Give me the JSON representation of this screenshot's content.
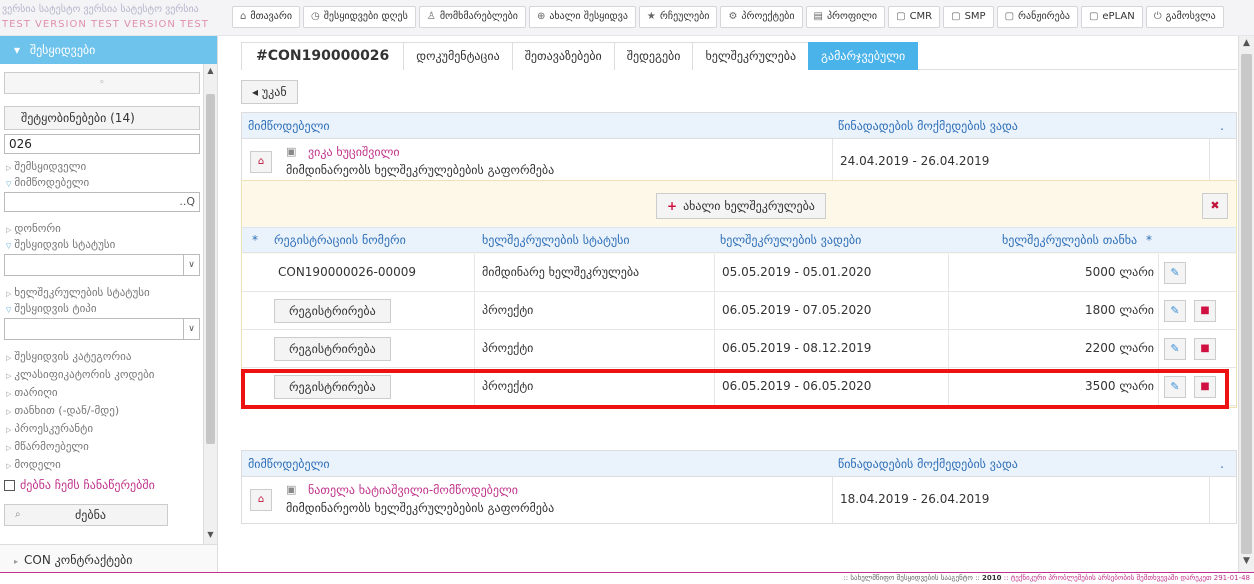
{
  "watermark": {
    "line1": "ვერსია  სატესტო ვერსია  სატესტო ვერსია",
    "line2": "TEST VERSION  TEST VERSION  TEST"
  },
  "topnav": [
    {
      "icon": "home-icon",
      "glyph": "⌂",
      "label": "მთავარი"
    },
    {
      "icon": "clock-icon",
      "glyph": "◷",
      "label": "შესყიდვები დღეს"
    },
    {
      "icon": "user-icon",
      "glyph": "♙",
      "label": "მომხმარებლები"
    },
    {
      "icon": "plus-circle-icon",
      "glyph": "⊕",
      "label": "ახალი შესყიდვა"
    },
    {
      "icon": "star-icon",
      "glyph": "★",
      "label": "რჩეულები"
    },
    {
      "icon": "gear-icon",
      "glyph": "⚙",
      "label": "პროექტები"
    },
    {
      "icon": "card-icon",
      "glyph": "▤",
      "label": "პროფილი"
    },
    {
      "icon": "doc-icon",
      "glyph": "▢",
      "label": "CMR"
    },
    {
      "icon": "doc-icon",
      "glyph": "▢",
      "label": "SMP"
    },
    {
      "icon": "doc-icon",
      "glyph": "▢",
      "label": "რანჟირება"
    },
    {
      "icon": "doc-icon",
      "glyph": "▢",
      "label": "ePLAN"
    },
    {
      "icon": "power-icon",
      "glyph": "⏻",
      "label": "გამოსვლა"
    }
  ],
  "sidebar": {
    "header": "შესყიდვები",
    "header_glyph": "▾",
    "small_btn_glyph": "◦",
    "notifications": "შეტყობინებები (14)",
    "code_value": "026",
    "labels": {
      "buyer": "შემსყიდველი",
      "supplier": "მიმწოდებელი",
      "date": "დონორი",
      "procurement_status": "შესყიდვის სტატუსი",
      "contract_status": "ხელშეკრულების სტატუსი",
      "procurement_type": "შესყიდვის ტიპი",
      "procurement_category": "შესყიდვის კატეგორია",
      "classifier_code": "კლასიფიკატორის კოდები",
      "date2": "თარიღი",
      "amount": "თანხით (-დან/-მდე)",
      "project_name": "პროესკურანტი",
      "producer": "მწარმოებელი",
      "model": "მოდელი"
    },
    "supplier_suffix": "..Q",
    "search_my_records": "ძებნა ჩემს ჩანაწერებში",
    "search_btn": "ძებნა",
    "search_glyph": "⌕",
    "footer": "CON კონტრაქტები",
    "footer_glyph": "▸"
  },
  "tabs": [
    {
      "label": "#CON190000026",
      "active": false
    },
    {
      "label": "დოკუმენტაცია",
      "active": false
    },
    {
      "label": "შეთავაზებები",
      "active": false
    },
    {
      "label": "შედეგები",
      "active": false
    },
    {
      "label": "ხელშეკრულება",
      "active": false
    },
    {
      "label": "გამარჯვებული",
      "active": true
    }
  ],
  "back_btn": "◂ უკან",
  "supplier_header": {
    "col1": "მიმწოდებელი",
    "col2": "წინადადების მოქმედების ვადა",
    "col3": "."
  },
  "supplier1": {
    "name": "ვიკა ხუციშვილი",
    "status": "მიმდინარეობს ხელშეკრულებების გაფორმება",
    "dates": "24.04.2019 - 26.04.2019"
  },
  "supplier2": {
    "name": "ნათელა ხატიაშვილი-მომწოდებელი",
    "status": "მიმდინარეობს ხელშეკრულებების გაფორმება",
    "dates": "18.04.2019 - 26.04.2019"
  },
  "new_contract_btn": "ახალი ხელშეკრულება",
  "contract_table": {
    "star": "*",
    "col_reg": "რეგისტრაციის ნომერი",
    "col_status": "ხელშეკრულების სტატუსი",
    "col_dates": "ხელშეკრულების ვადები",
    "col_amount": "ხელშეკრულების თანხა",
    "rows": [
      {
        "reg": "CON190000026-00009",
        "reg_is_button": false,
        "status": "მიმდინარე ხელშეკრულება",
        "dates": "05.05.2019 - 05.01.2020",
        "amount": "5000 ლარი",
        "delete": false
      },
      {
        "reg": "რეგისტრირება",
        "reg_is_button": true,
        "status": "პროექტი",
        "dates": "06.05.2019 - 07.05.2020",
        "amount": "1800 ლარი",
        "delete": true
      },
      {
        "reg": "რეგისტრირება",
        "reg_is_button": true,
        "status": "პროექტი",
        "dates": "06.05.2019 - 08.12.2019",
        "amount": "2200 ლარი",
        "delete": true
      },
      {
        "reg": "რეგისტრირება",
        "reg_is_button": true,
        "status": "პროექტი",
        "dates": "06.05.2019 - 06.05.2020",
        "amount": "3500 ლარი",
        "delete": true
      }
    ]
  },
  "footer": {
    "left": ":: სახელმწიფო შესყიდვების სააგენტო ::",
    "year": "2010",
    "right": ":: ტექნიკური პრობლემების არსებობის შემთხვევაში დარეკეთ 291-01-48"
  },
  "colors": {
    "accent": "#4ab3ea",
    "sidebar_header": "#6ec3ec",
    "link": "#c0338a",
    "highlight": "#ee1111"
  }
}
